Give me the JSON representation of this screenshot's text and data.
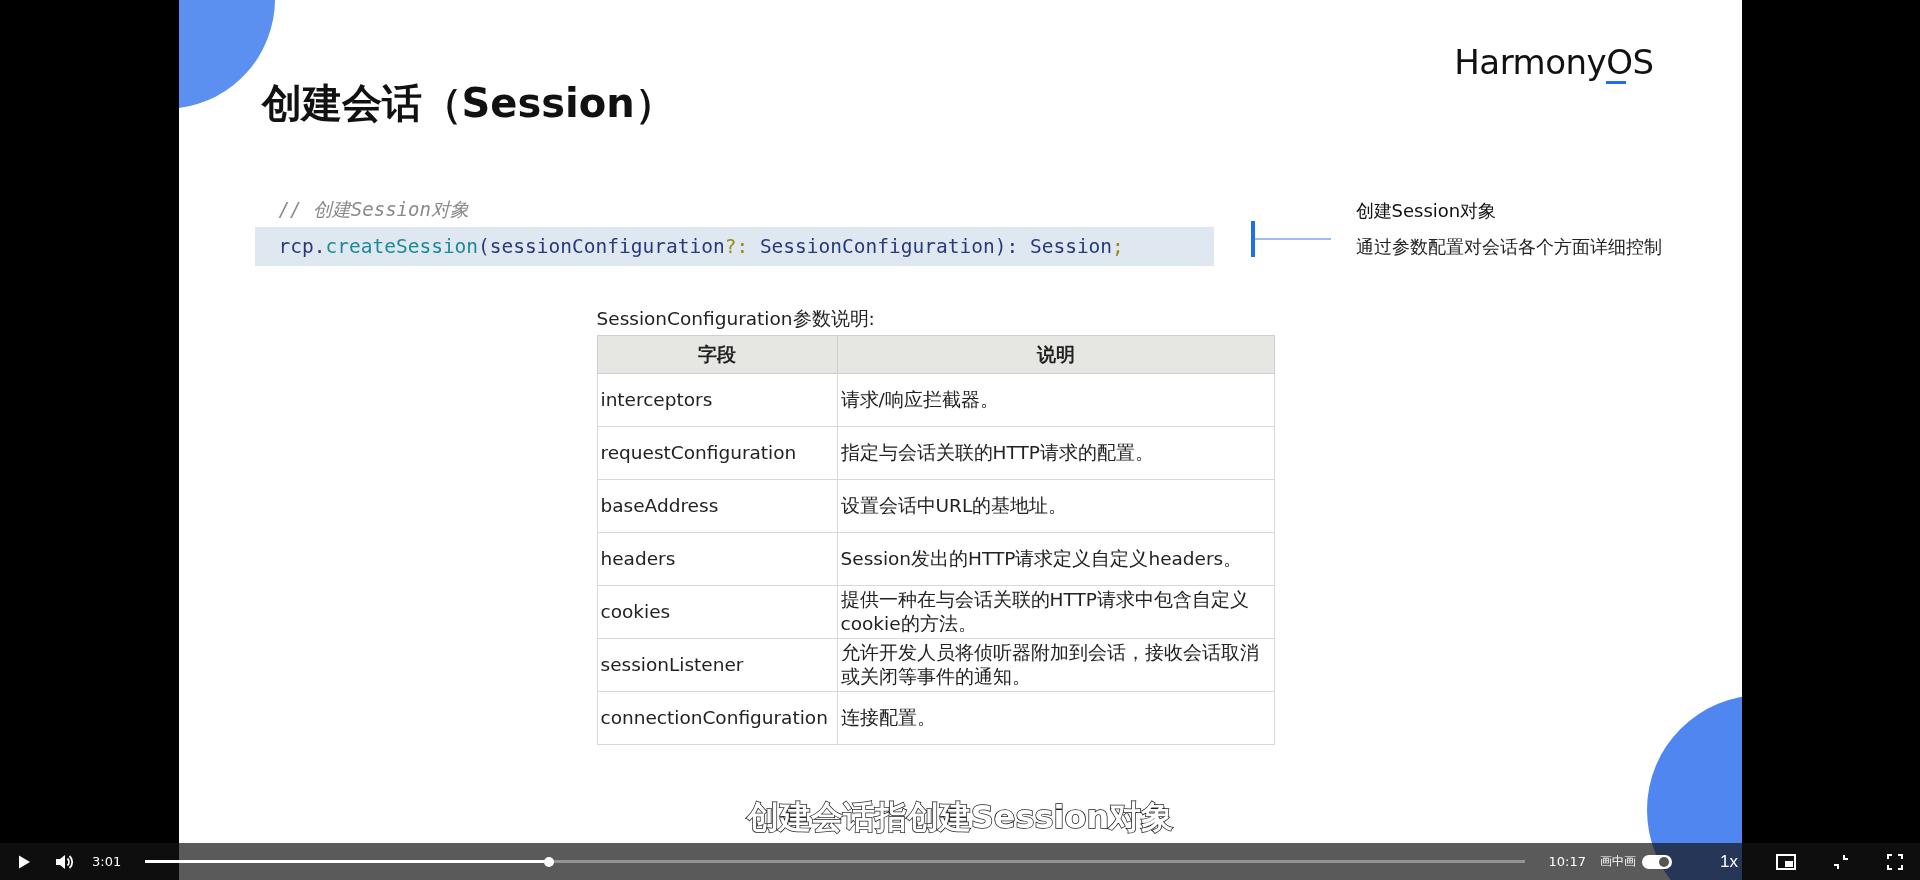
{
  "slide": {
    "title": "创建会话（Session）",
    "logo": "HarmonyOS",
    "code": {
      "comment": "// 创建Session对象",
      "tokens": [
        {
          "text": "rcp",
          "kind": "ident"
        },
        {
          "text": ".",
          "kind": "punct"
        },
        {
          "text": "createSession",
          "kind": "func"
        },
        {
          "text": "(sessionConfiguration",
          "kind": "ident"
        },
        {
          "text": "?:",
          "kind": "op"
        },
        {
          "text": " SessionConfiguration",
          "kind": "type"
        },
        {
          "text": "): ",
          "kind": "ident"
        },
        {
          "text": "Session",
          "kind": "type"
        },
        {
          "text": ";",
          "kind": "op"
        }
      ]
    },
    "callout": {
      "title": "创建Session对象",
      "text": "通过参数配置对会话各个方面详细控制"
    },
    "table": {
      "caption": "SessionConfiguration参数说明:",
      "columns": [
        "字段",
        "说明"
      ],
      "rows": [
        {
          "field": "interceptors",
          "description": "请求/响应拦截器。"
        },
        {
          "field": "requestConfiguration",
          "description": "指定与会话关联的HTTP请求的配置。"
        },
        {
          "field": "baseAddress",
          "description": "设置会话中URL的基地址。"
        },
        {
          "field": "headers",
          "description": "Session发出的HTTP请求定义自定义headers。"
        },
        {
          "field": "cookies",
          "description": "提供一种在与会话关联的HTTP请求中包含自定义cookie的方法。"
        },
        {
          "field": "sessionListener",
          "description": "允许开发人员将侦听器附加到会话，接收会话取消或关闭等事件的通知。"
        },
        {
          "field": "connectionConfiguration",
          "description": "连接配置。"
        }
      ]
    }
  },
  "subtitle": "创建会话指创建Session对象",
  "player": {
    "playing": false,
    "current_time": "3:01",
    "duration": "10:17",
    "level": 0.293,
    "pip_label": "画中画",
    "pip_on": true,
    "speed": "1x"
  }
}
